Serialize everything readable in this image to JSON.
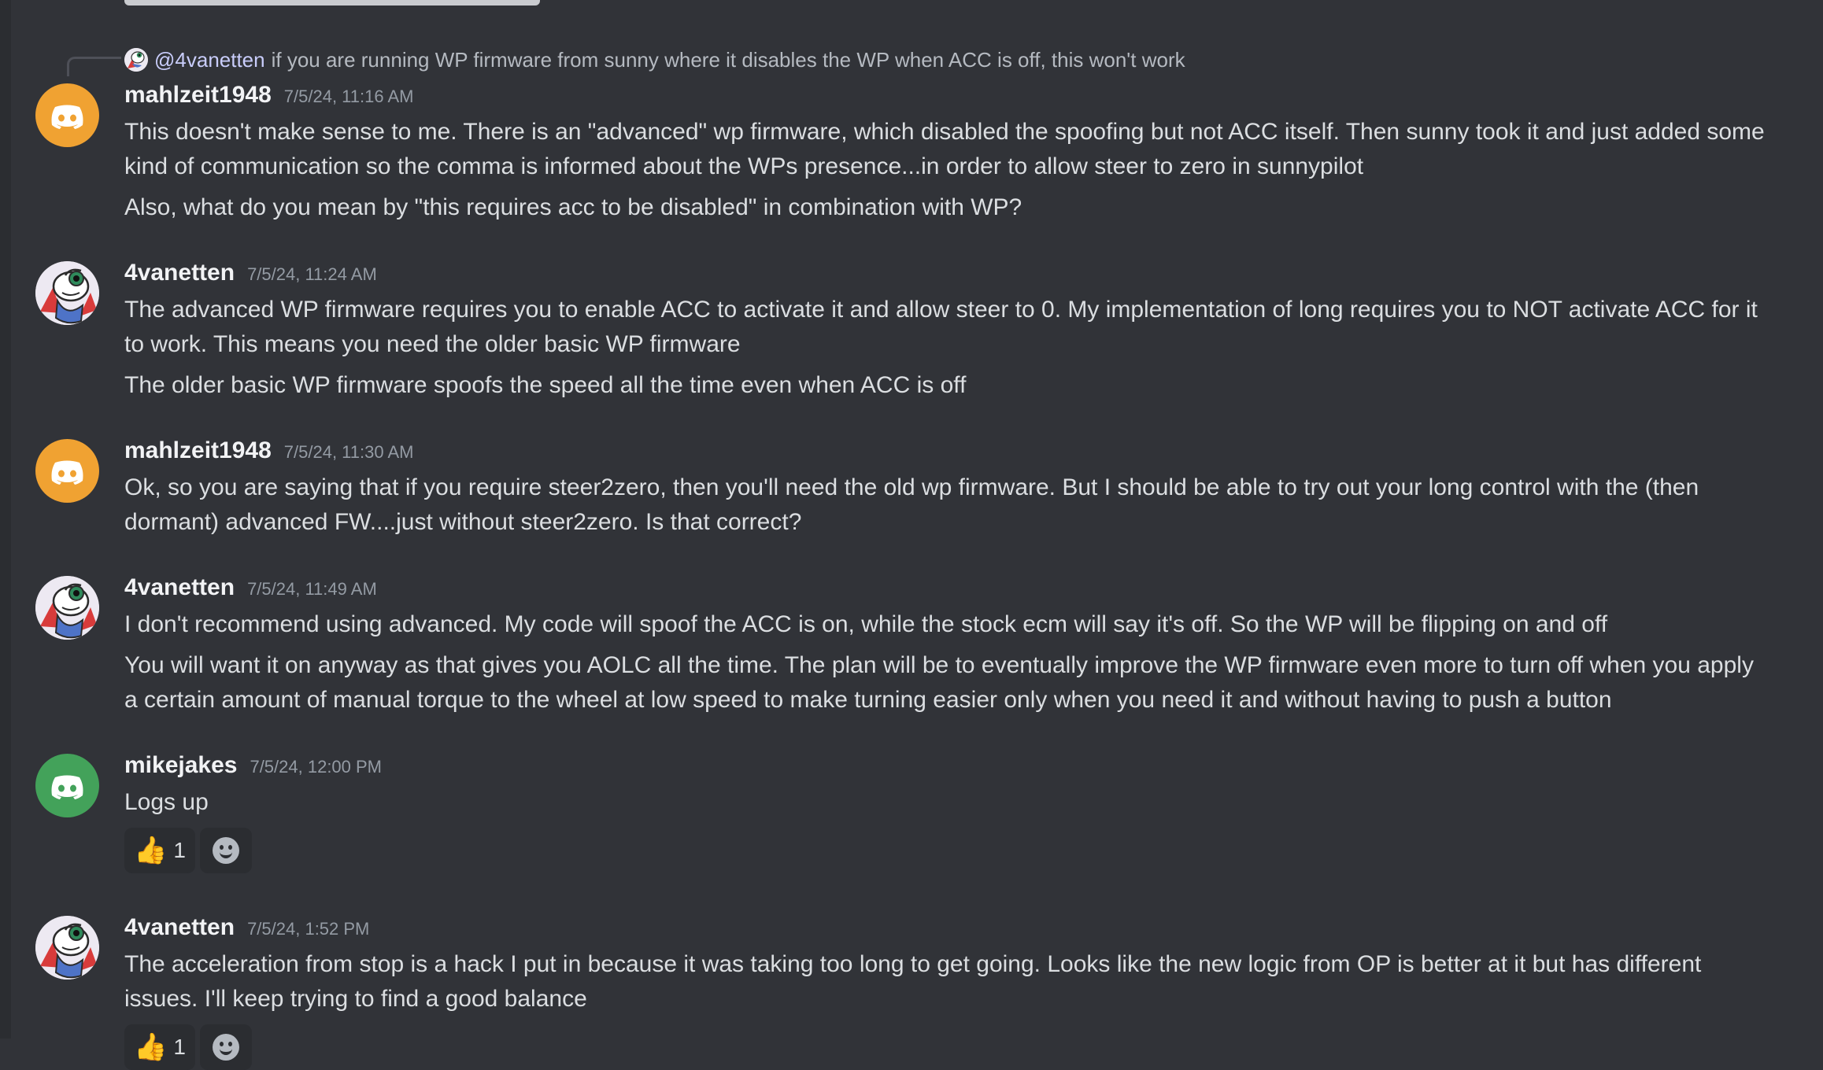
{
  "reply": {
    "mention": "@4vanetten",
    "text": "if you are running WP firmware from sunny where it disables the WP when ACC is off, this won't work"
  },
  "messages": [
    {
      "username": "mahlzeit1948",
      "timestamp": "7/5/24, 11:16 AM",
      "avatar": "discord-logo-icon",
      "avatar_color": "#f0a232",
      "lines": [
        "This doesn't make sense to me. There is an \"advanced\" wp firmware, which disabled the spoofing but not ACC itself. Then sunny took it and just added some",
        "kind of communication so the comma is informed about the WPs presence...in order to allow steer to zero in sunnypilot",
        "Also, what do you mean by \"this requires acc to be disabled\" in combination with WP?"
      ]
    },
    {
      "username": "4vanetten",
      "timestamp": "7/5/24, 11:24 AM",
      "avatar": "cartoon-avatar-icon",
      "lines": [
        "The advanced WP firmware requires you to enable ACC to activate it and allow steer to 0.  My implementation of long requires you to NOT activate ACC for it",
        "to work.  This means you need the older basic WP firmware",
        "The older basic WP firmware spoofs the speed all the time even when ACC is off"
      ]
    },
    {
      "username": "mahlzeit1948",
      "timestamp": "7/5/24, 11:30 AM",
      "avatar": "discord-logo-icon",
      "avatar_color": "#f0a232",
      "lines": [
        "Ok, so you are saying that if you require steer2zero, then you'll need the old wp firmware. But I should be able to try out your long control with the (then",
        "dormant) advanced FW....just without steer2zero. Is that correct?"
      ]
    },
    {
      "username": "4vanetten",
      "timestamp": "7/5/24, 11:49 AM",
      "avatar": "cartoon-avatar-icon",
      "lines": [
        "I don't recommend using advanced.  My code will spoof the ACC is on, while the stock ecm will say it's off. So the WP will be flipping on and off",
        "You will want it on anyway as that gives you AOLC all the time.  The plan will be to eventually improve the WP firmware even more to turn off when you apply",
        "a certain amount of manual torque to the wheel at low speed to make turning easier only when you need it and without having to push a button"
      ]
    },
    {
      "username": "mikejakes",
      "timestamp": "7/5/24, 12:00 PM",
      "avatar": "discord-logo-icon",
      "avatar_color": "#43a25a",
      "lines": [
        "Logs up"
      ],
      "reactions": [
        {
          "emoji": "👍",
          "count": "1"
        }
      ]
    },
    {
      "username": "4vanetten",
      "timestamp": "7/5/24, 1:52 PM",
      "avatar": "cartoon-avatar-icon",
      "lines": [
        "The acceleration from stop is a hack I put in because it was taking too long to get going. Looks like the new logic from OP is better at it but has different",
        "issues.  I'll keep trying to find a good balance"
      ],
      "reactions": [
        {
          "emoji": "👍",
          "count": "1"
        }
      ]
    }
  ]
}
